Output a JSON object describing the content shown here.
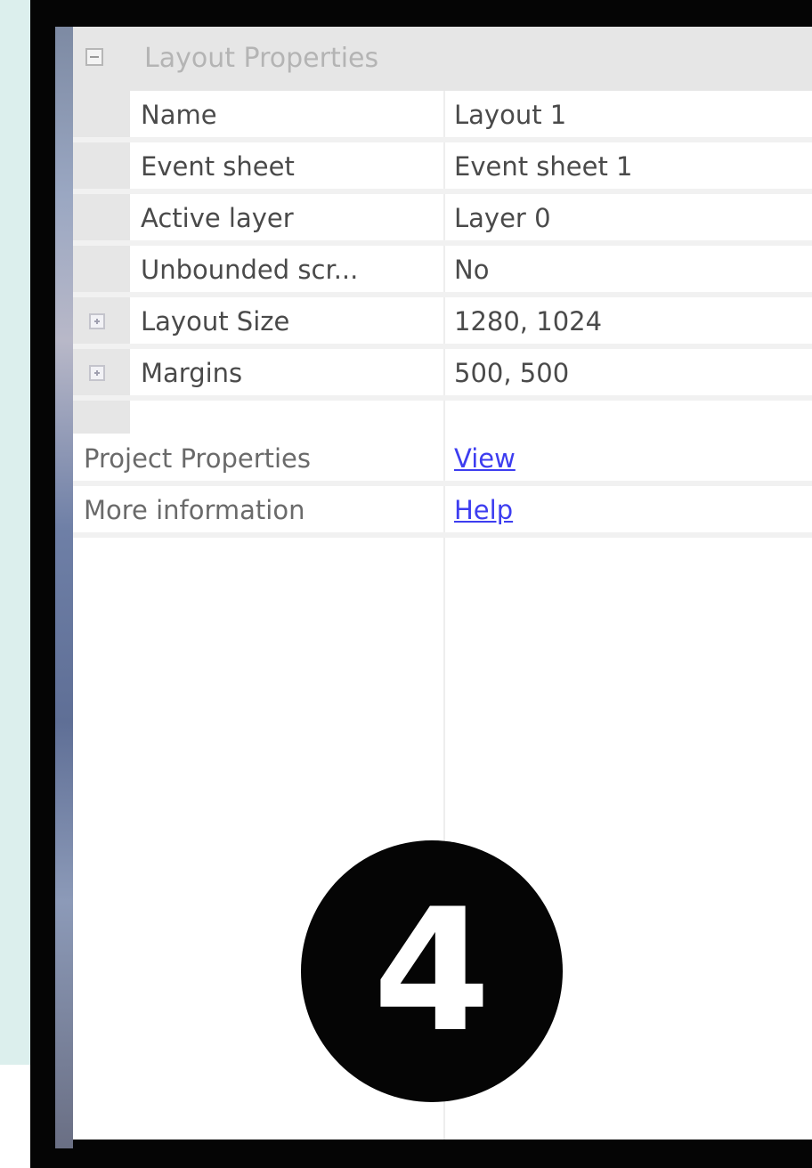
{
  "section": {
    "title": "Layout Properties",
    "collapse_icon": "minus-box-icon"
  },
  "layout_rows": [
    {
      "label": "Name",
      "value": "Layout 1"
    },
    {
      "label": "Event sheet",
      "value": "Event sheet 1"
    },
    {
      "label": "Active layer",
      "value": "Layer 0"
    },
    {
      "label": "Unbounded scr...",
      "value": "No"
    },
    {
      "label": "Layout Size",
      "value": "1280, 1024",
      "expand_icon": "plus-box-icon"
    },
    {
      "label": "Margins",
      "value": "500, 500",
      "expand_icon": "plus-box-icon"
    }
  ],
  "project_rows": [
    {
      "label": "Project Properties",
      "link": "View"
    },
    {
      "label": "More information",
      "link": "Help"
    }
  ],
  "badge": {
    "number": "4"
  },
  "colors": {
    "link": "#3d3df0",
    "header_bg": "#e6e6e6",
    "frame": "#050505",
    "page_bg": "#dcefed"
  }
}
